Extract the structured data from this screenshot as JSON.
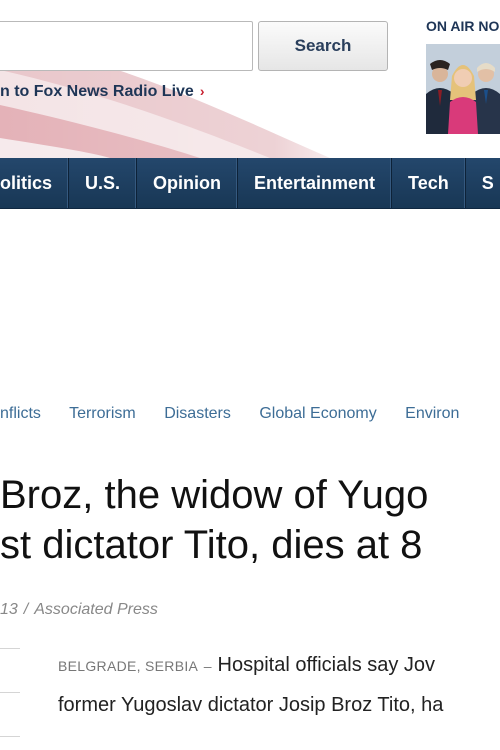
{
  "header": {
    "search": {
      "value": "",
      "placeholder": "",
      "button_label": "Search"
    },
    "radio_link": {
      "label": "n to Fox News Radio Live",
      "chevron": "›"
    },
    "on_air": {
      "label": "ON AIR NO"
    }
  },
  "nav": {
    "items": [
      "olitics",
      "U.S.",
      "Opinion",
      "Entertainment",
      "Tech",
      "S"
    ]
  },
  "topics": [
    "nflicts",
    "Terrorism",
    "Disasters",
    "Global Economy",
    "Environ"
  ],
  "article": {
    "headline_line1": "Broz, the widow of Yugo",
    "headline_line2": "st dictator Tito, dies at 8",
    "byline_date": "13",
    "byline_separator": "/",
    "byline_source": "Associated Press",
    "dateline": "BELGRADE, SERBIA",
    "dateline_dash": "–",
    "body_line1": "Hospital officials say Jov",
    "body_line2": "former Yugoslav dictator Josip Broz Tito, ha"
  },
  "colors": {
    "nav_bg": "#1f3f60",
    "link": "#3d6d96",
    "accent_red": "#c8202f"
  }
}
